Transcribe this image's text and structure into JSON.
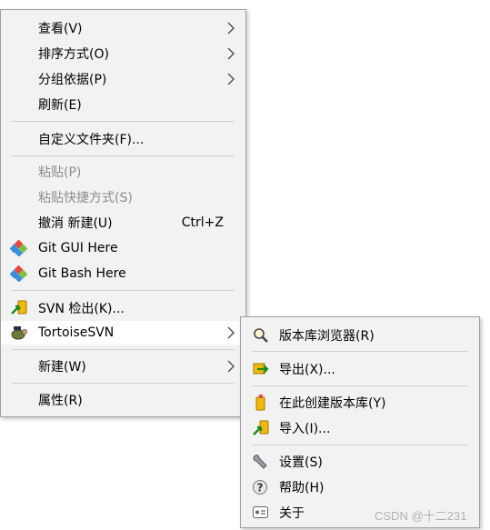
{
  "main_menu": {
    "items": [
      {
        "label": "查看(V)"
      },
      {
        "label": "排序方式(O)"
      },
      {
        "label": "分组依据(P)"
      },
      {
        "label": "刷新(E)"
      },
      {
        "label": "自定义文件夹(F)..."
      },
      {
        "label": "粘贴(P)",
        "disabled": true
      },
      {
        "label": "粘贴快捷方式(S)",
        "disabled": true
      },
      {
        "label": "撤消 新建(U)",
        "shortcut": "Ctrl+Z"
      },
      {
        "label": "Git GUI Here",
        "icon": "git-diamond-icon"
      },
      {
        "label": "Git Bash Here",
        "icon": "git-diamond-icon"
      },
      {
        "label": "SVN 检出(K)...",
        "icon": "svn-checkout-icon"
      },
      {
        "label": "TortoiseSVN",
        "icon": "tortoise-svn-icon",
        "highlighted": true
      },
      {
        "label": "新建(W)"
      },
      {
        "label": "属性(R)"
      }
    ]
  },
  "sub_menu": {
    "items": [
      {
        "label": "版本库浏览器(R)",
        "icon": "repo-browser-icon"
      },
      {
        "label": "导出(X)...",
        "icon": "export-icon"
      },
      {
        "label": "在此创建版本库(Y)",
        "icon": "create-repo-icon"
      },
      {
        "label": "导入(I)...",
        "icon": "import-icon"
      },
      {
        "label": "设置(S)",
        "icon": "settings-wrench-icon"
      },
      {
        "label": "帮助(H)",
        "icon": "help-icon"
      },
      {
        "label": "关于",
        "icon": "about-icon"
      }
    ]
  },
  "watermark": "CSDN @十二231",
  "colors": {
    "menu_bg": "#f2f2f2",
    "hover_bg": "#ffffff",
    "disabled_text": "#8c8c8c",
    "separator": "#cfcfcf"
  }
}
